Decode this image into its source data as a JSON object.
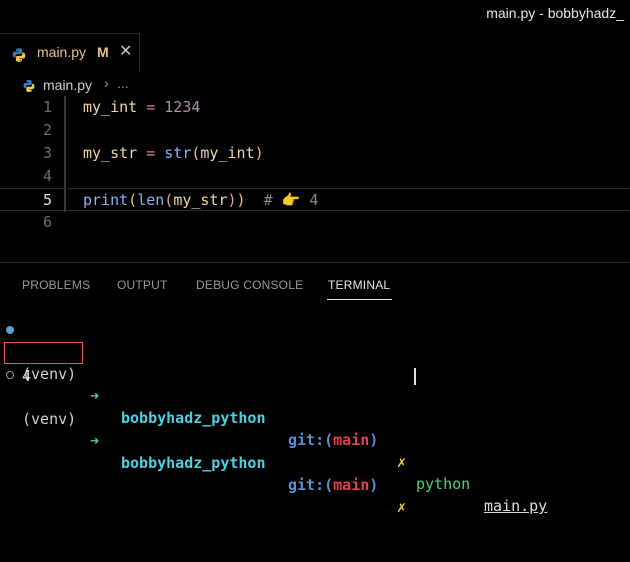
{
  "window": {
    "title": "main.py - bobbyhadz_"
  },
  "tab": {
    "filename": "main.py",
    "status": "M",
    "close_glyph": "✕"
  },
  "breadcrumb": {
    "file": "main.py",
    "separator": "›",
    "more": "..."
  },
  "editor": {
    "lines": [
      {
        "number": "1",
        "var": "my_int",
        "op": " = ",
        "value": "1234"
      },
      {
        "number": "2"
      },
      {
        "number": "3",
        "var": "my_str",
        "op": " = ",
        "fn": "str",
        "arg": "my_int"
      },
      {
        "number": "4"
      },
      {
        "number": "5",
        "fn1": "print",
        "fn2": "len",
        "arg": "my_str",
        "comment_hash": "# ",
        "emoji": "👉",
        "comment_value": " 4"
      },
      {
        "number": "6"
      }
    ],
    "active_line": 5
  },
  "panel": {
    "tabs": [
      "PROBLEMS",
      "OUTPUT",
      "DEBUG CONSOLE",
      "TERMINAL"
    ],
    "active_tab": "TERMINAL"
  },
  "terminal": {
    "venv": "(venv)",
    "arrow": "➜",
    "dir": "bobbyhadz_python",
    "git_prefix": "git:(",
    "branch": "main",
    "git_suffix": ")",
    "dirty": "✗",
    "command": "python",
    "argument": "main.py",
    "output": "4"
  },
  "colors": {
    "background": "#000000",
    "modified": "#e8c48a",
    "terminal_dir": "#4dd0e1",
    "terminal_branch": "#e0424f",
    "highlight_box": "#e05a5a"
  },
  "icons": {
    "python": "python-file-icon"
  }
}
